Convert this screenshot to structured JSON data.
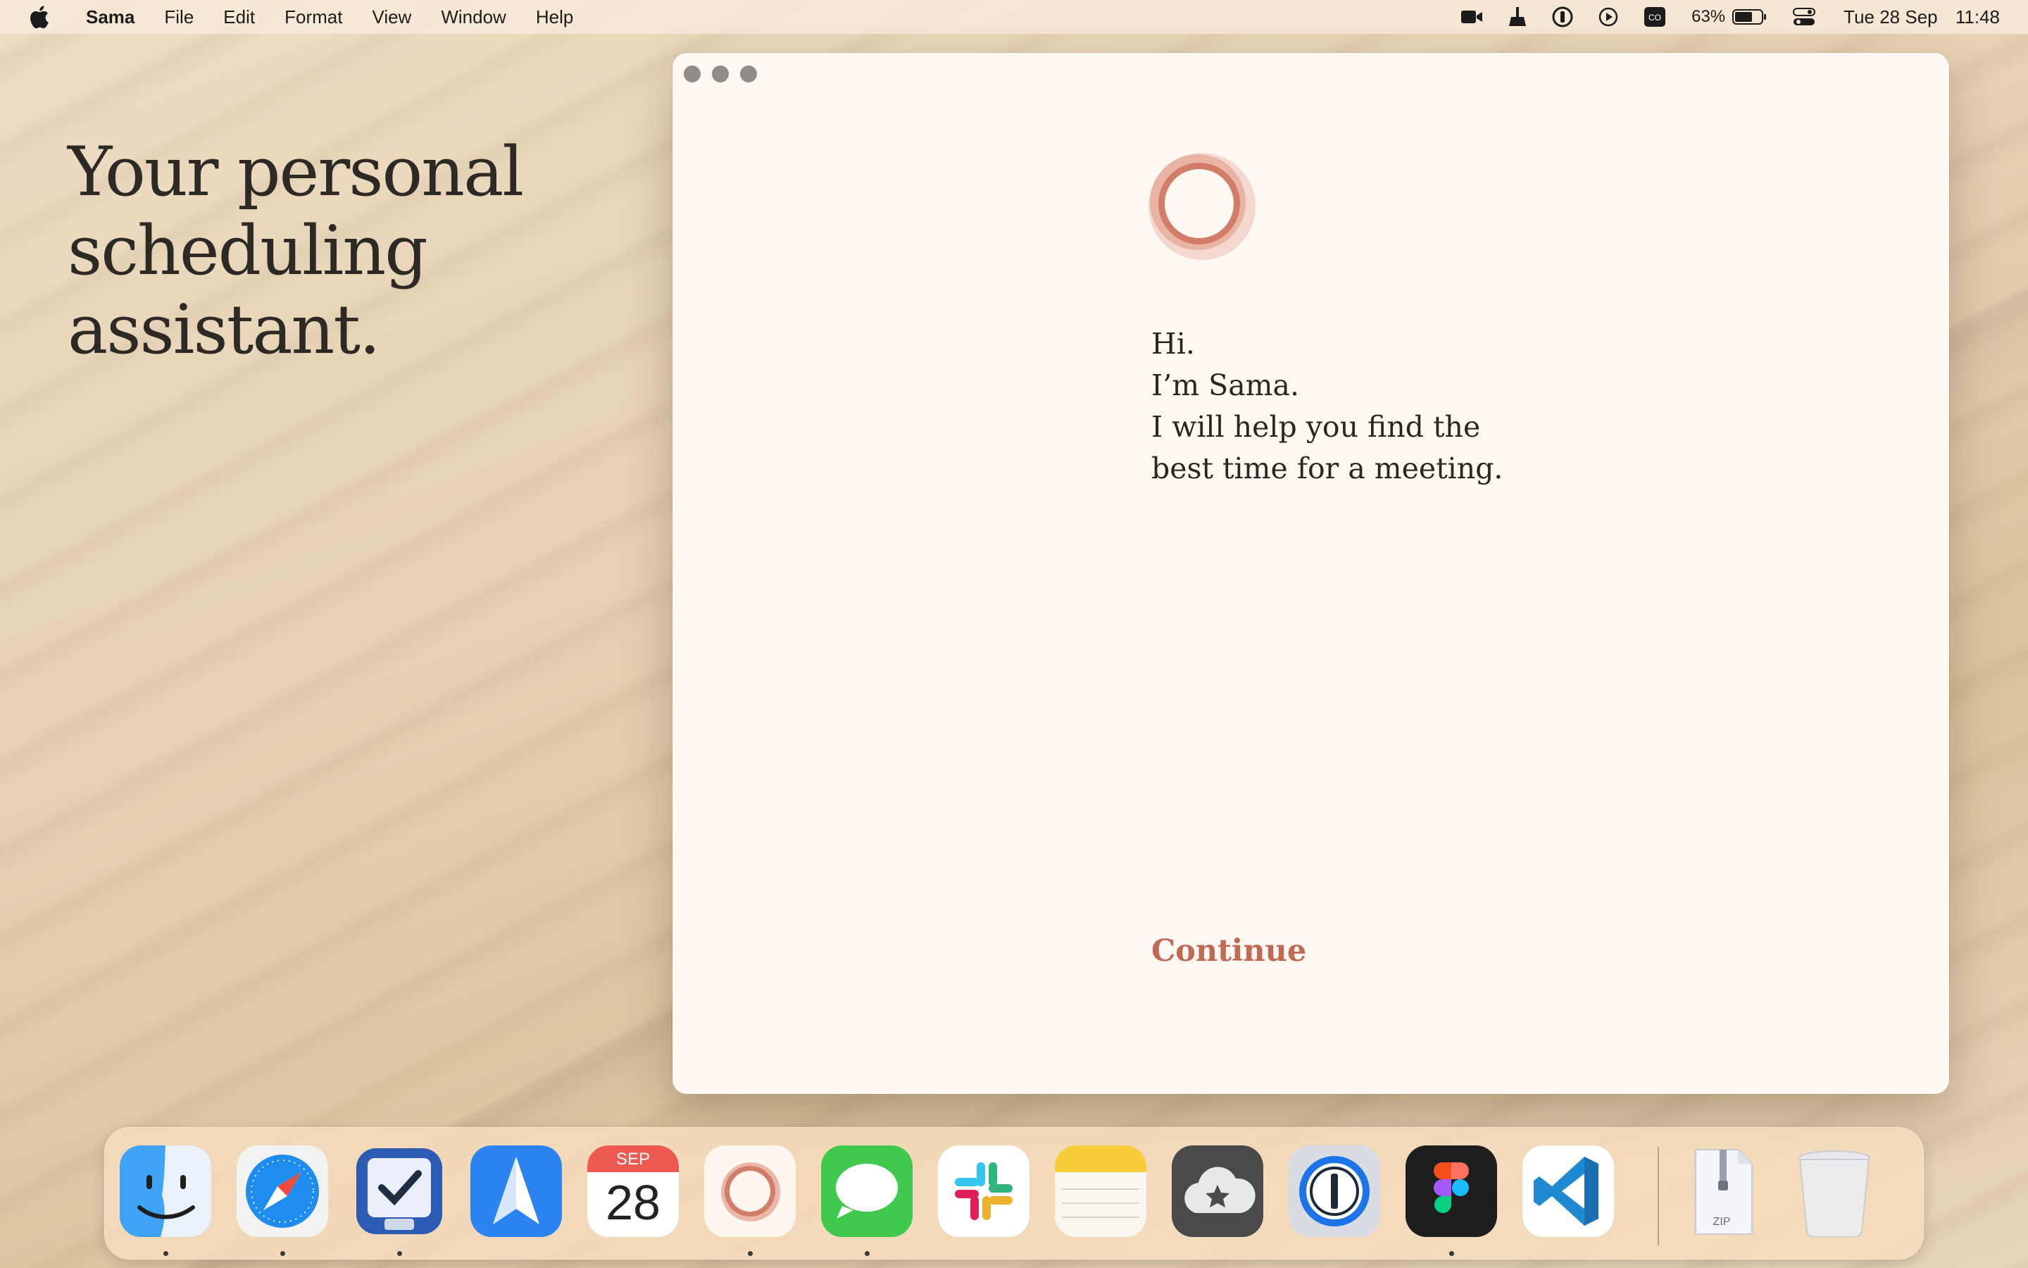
{
  "menubar": {
    "app_name": "Sama",
    "items": [
      "File",
      "Edit",
      "Format",
      "View",
      "Window",
      "Help"
    ],
    "battery_percent": "63%",
    "date": "Tue 28 Sep",
    "time": "11:48",
    "tray_icons": [
      "video-camera-icon",
      "broom-icon",
      "password-manager-icon",
      "play-icon",
      "co-icon",
      "battery-icon",
      "control-center-icon"
    ]
  },
  "hero": {
    "line1": "Your personal",
    "line2": "scheduling",
    "line3": "assistant."
  },
  "window": {
    "greeting_lines": [
      "Hi.",
      "I’m Sama.",
      "I will help you find the",
      "best time for a meeting."
    ],
    "continue_label": "Continue",
    "accent_color": "#c06a55"
  },
  "dock": {
    "calendar_month": "SEP",
    "calendar_day": "28",
    "zip_label": "ZIP",
    "apps": [
      "Finder",
      "Safari",
      "OmniFocus",
      "Spark",
      "Calendar",
      "Sama",
      "Messages",
      "Slack",
      "Notes",
      "Cloud",
      "1Password",
      "Figma",
      "Visual Studio Code",
      "Archive",
      "Trash"
    ]
  }
}
